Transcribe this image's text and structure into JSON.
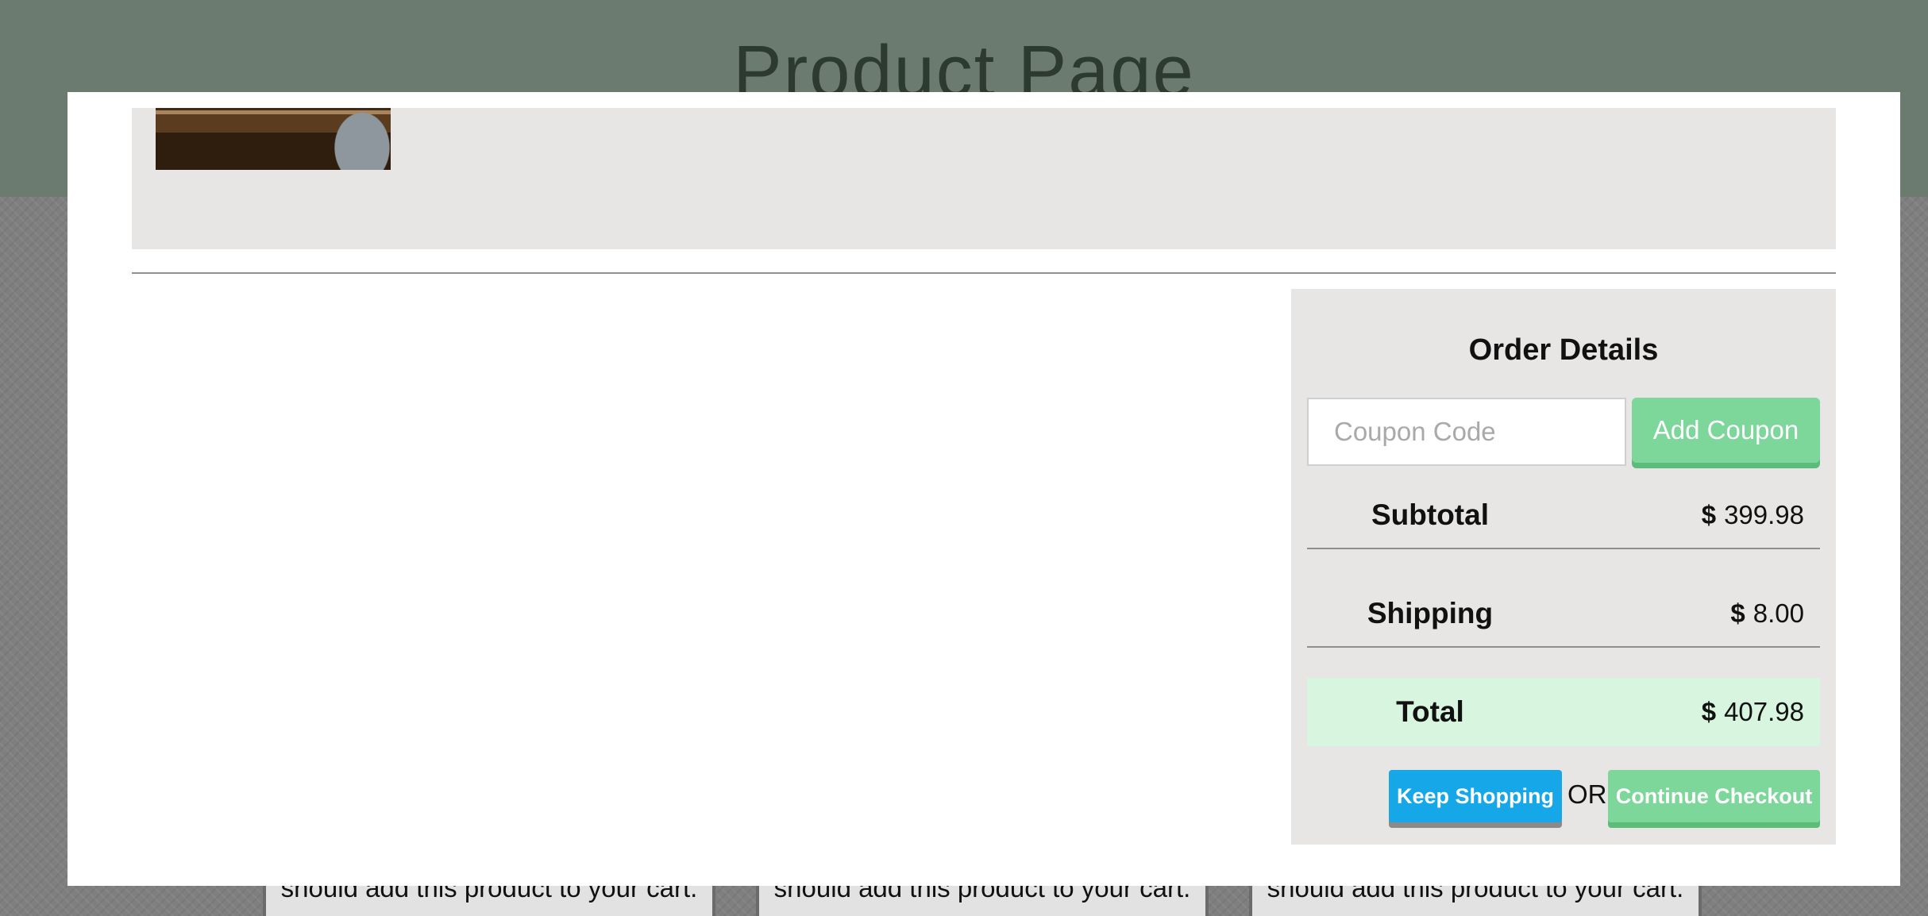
{
  "page": {
    "title": "Product Page"
  },
  "background_cards": [
    {
      "text": "should add this product to your cart."
    },
    {
      "text": "should add this product to your cart."
    },
    {
      "text": "should add this product to your cart."
    }
  ],
  "order": {
    "title": "Order Details",
    "coupon_placeholder": "Coupon Code",
    "coupon_value": "",
    "add_coupon_label": "Add Coupon",
    "currency": "$",
    "rows": {
      "subtotal": {
        "label": "Subtotal",
        "value": "399.98"
      },
      "shipping": {
        "label": "Shipping",
        "value": "8.00"
      },
      "total": {
        "label": "Total",
        "value": "407.98"
      }
    },
    "keep_shopping_label": "Keep Shopping",
    "or_label": "OR",
    "continue_label": "Continue Checkout"
  },
  "colors": {
    "header_bg": "#6c7b6f",
    "panel_bg": "#e7e6e4",
    "green_button": "#7dd69a",
    "blue_button": "#16a7e8",
    "total_highlight": "#d8f5e0"
  }
}
